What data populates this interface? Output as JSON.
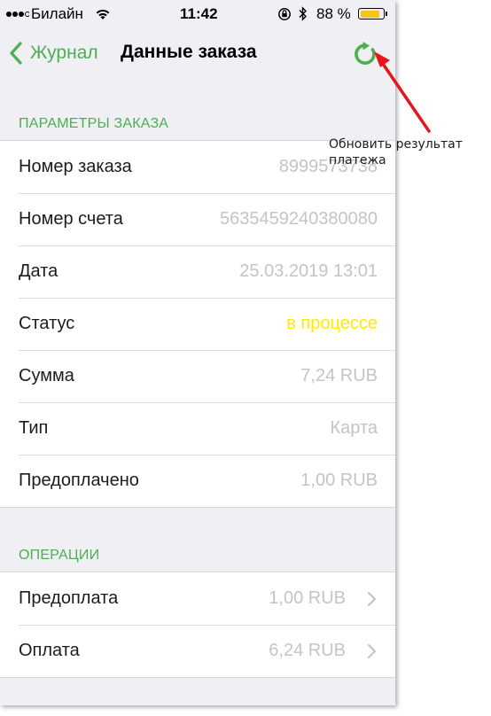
{
  "status_bar": {
    "carrier": "Билайн",
    "time": "11:42",
    "battery": "88 %",
    "battery_level": 0.88,
    "battery_color": "#f5c518",
    "icons": [
      "signal-dots-icon",
      "wifi-icon",
      "orientation-lock-icon",
      "bluetooth-icon",
      "battery-icon"
    ]
  },
  "nav": {
    "back_label": "Журнал",
    "title": "Данные заказа",
    "accent_color": "#4caf50",
    "icons": [
      "chevron-left-icon",
      "refresh-icon"
    ]
  },
  "sections": [
    {
      "header": "ПАРАМЕТРЫ ЗАКАЗА",
      "rows": [
        {
          "label": "Номер заказа",
          "value": "8999573738"
        },
        {
          "label": "Номер счета",
          "value": "5635459240380080"
        },
        {
          "label": "Дата",
          "value": "25.03.2019 13:01"
        },
        {
          "label": "Статус",
          "value": "в процессе"
        },
        {
          "label": "Сумма",
          "value": "7,24 RUB"
        },
        {
          "label": "Тип",
          "value": "Карта"
        },
        {
          "label": "Предоплачено",
          "value": "1,00 RUB"
        }
      ]
    },
    {
      "header": "ОПЕРАЦИИ",
      "rows": [
        {
          "label": "Предоплата",
          "value": "1,00 RUB"
        },
        {
          "label": "Оплата",
          "value": "6,24 RUB"
        }
      ]
    }
  ],
  "colors": {
    "status_in_progress": "#ffeb00",
    "value_gray": "#c4c4c8",
    "annotation_arrow": "#e8141b"
  },
  "annotation": {
    "line1": "Обновить результат",
    "line2": "платежа"
  }
}
